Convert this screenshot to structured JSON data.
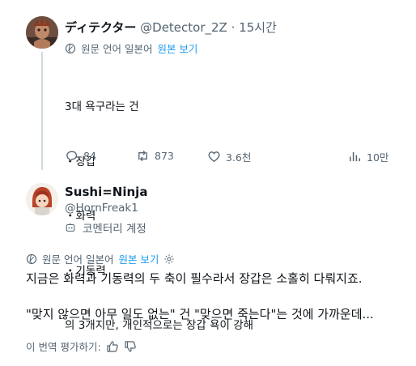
{
  "tweet1": {
    "display_name": "ディテクター",
    "handle": "@Detector_2Z",
    "separator": "·",
    "time": "15시간",
    "translation": {
      "label": "원문 언어 일본어",
      "show_original": "원본 보기"
    },
    "lines": [
      "3대 욕구라는 건",
      "・장갑",
      "・화력",
      "・기동력",
      "의 3개지만, 개인적으로는 장갑 욕이 강해"
    ],
    "actions": {
      "replies": "84",
      "retweets": "873",
      "likes": "3.6천",
      "views": "10만"
    }
  },
  "tweet2": {
    "display_name": "Sushi=Ninja",
    "handle": "@HornFreak1",
    "badge": "코멘터리 계정",
    "translation": {
      "label": "원문 언어 일본어",
      "show_original": "원본 보기"
    },
    "lines": [
      "지금은 화력과 기동력의 두 축이 필수라서 장갑은 소홀히 다뤄지죠.",
      "",
      "\"맞지 않으면 아무 일도 없는\" 건 \"맞으면 죽는다\"는 것에 가까운데..."
    ],
    "rate_label": "이 번역 평가하기:"
  },
  "colors": {
    "accent": "#1d9bf0",
    "muted": "#536471",
    "text": "#0f1419",
    "thread_line": "#cfd9de"
  }
}
